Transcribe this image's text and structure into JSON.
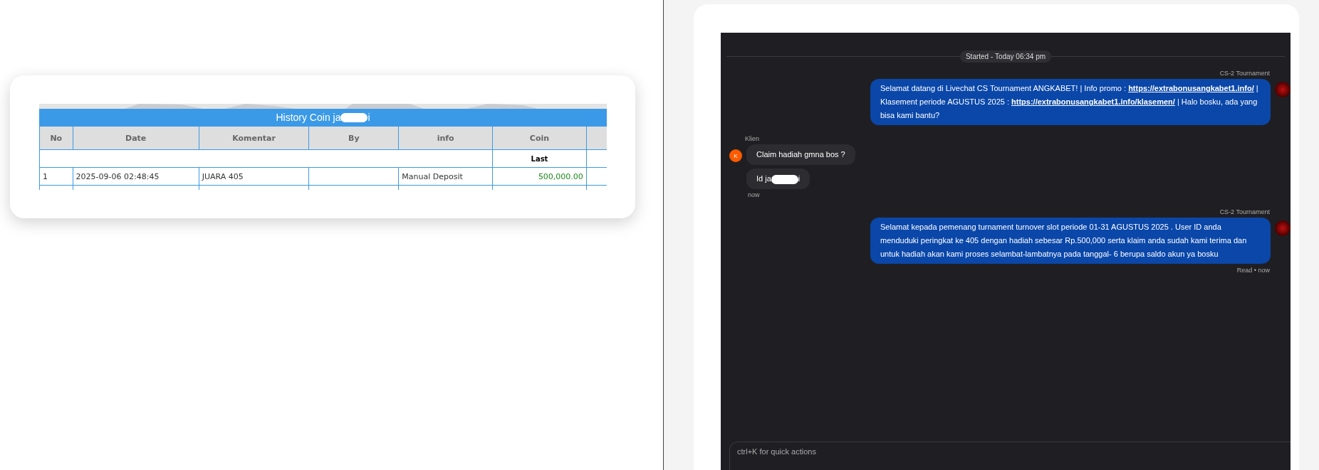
{
  "history_table": {
    "title": [
      {
        "kind": "text",
        "text": "History Coin ja"
      },
      {
        "kind": "redaction"
      },
      {
        "kind": "text",
        "text": "i"
      }
    ],
    "columns": [
      "No",
      "Date",
      "Komentar",
      "By",
      "info",
      "Coin"
    ],
    "subheader": {
      "coin": "Last"
    },
    "rows": [
      {
        "no": "1",
        "date": "2025-09-06 02:48:45",
        "komentar": "JUARA 405",
        "by": "",
        "info": "Manual Deposit",
        "coin": "500,000.00"
      }
    ]
  },
  "chat": {
    "started": "Started - Today 06:34 pm",
    "messages": [
      {
        "kind": "agent",
        "sender": "CS-2 Tournament",
        "segments": [
          {
            "kind": "text",
            "text": "Selamat datang di Livechat CS Tournament ANGKABET! | Info promo : "
          },
          {
            "kind": "link",
            "text": "https://extrabonusangkabet1.info/"
          },
          {
            "kind": "text",
            "text": " | Klasement periode AGUSTUS 2025 : "
          },
          {
            "kind": "link",
            "text": "https://extrabonusangkabet1.info/klasemen/"
          },
          {
            "kind": "text",
            "text": " | Halo bosku, ada yang bisa kami bantu?"
          }
        ]
      },
      {
        "kind": "client",
        "sender": "Klien",
        "avatar": "K",
        "bubbles": [
          [
            {
              "kind": "text",
              "text": "Claim hadiah gmna bos ?"
            }
          ],
          [
            {
              "kind": "text",
              "text": "Id ja"
            },
            {
              "kind": "redaction"
            },
            {
              "kind": "text",
              "text": "i"
            }
          ]
        ],
        "time": "now"
      },
      {
        "kind": "agent",
        "sender": "CS-2 Tournament",
        "segments": [
          {
            "kind": "text",
            "text": "Selamat kepada pemenang turnament turnover slot periode 01-31 AGUSTUS 2025 . User ID anda menduduki peringkat ke 405 dengan hadiah sebesar Rp.500,000 serta klaim anda sudah kami terima dan untuk hadiah akan kami proses selambat-lambatnya pada tanggal- 6 berupa saldo akun ya bosku"
          }
        ],
        "status": "Read • now"
      }
    ],
    "input": {
      "placeholder": "ctrl+K for quick actions"
    }
  }
}
